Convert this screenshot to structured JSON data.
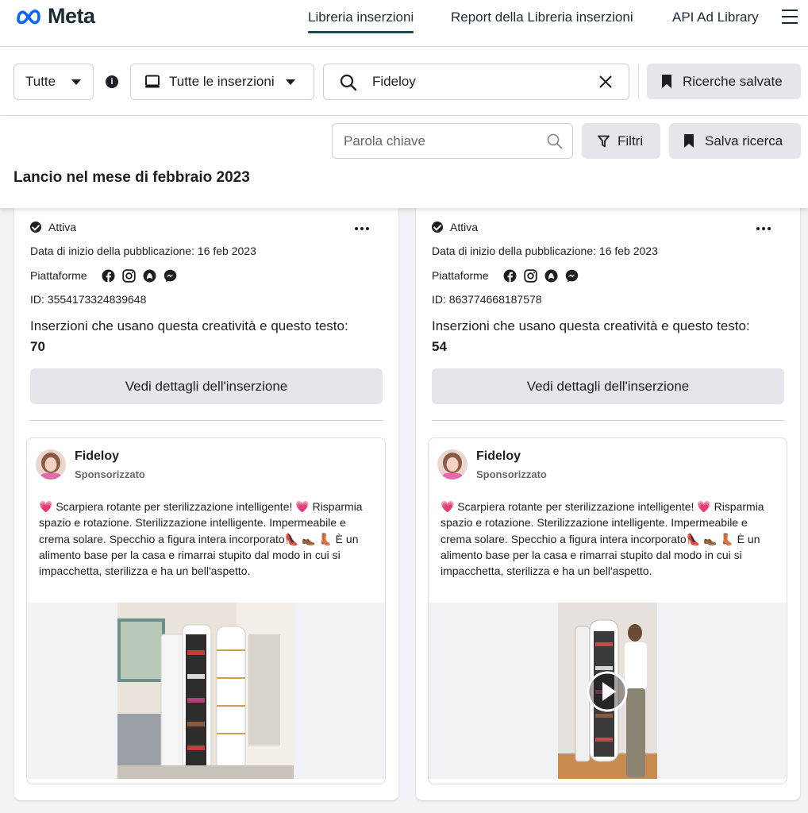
{
  "nav": {
    "brand": "Meta",
    "links": [
      "Libreria inserzioni",
      "Report della Libreria inserzioni",
      "API Ad Library"
    ]
  },
  "search": {
    "country": "Tutte",
    "ad_type": "Tutte le inserzioni",
    "query": "Fideloy",
    "saved_label": "Ricerche salvate"
  },
  "filters": {
    "keyword_placeholder": "Parola chiave",
    "filters_label": "Filtri",
    "save_label": "Salva ricerca"
  },
  "section_title": "Lancio nel mese di febbraio 2023",
  "cards": [
    {
      "status": "Attiva",
      "start_date": "Data di inizio della pubblicazione: 16 feb 2023",
      "platforms_label": "Piattaforme",
      "id": "ID: 3554173324839648",
      "usage_text": "Inserzioni che usano questa creatività e questo testo: ",
      "usage_count": "70",
      "details_button": "Vedi dettagli dell'inserzione",
      "advertiser": "Fideloy",
      "sponsored": "Sponsorizzato",
      "body": "💗 Scarpiera rotante per sterilizzazione intelligente! 💗 Risparmia spazio e rotazione. Sterilizzazione intelligente. Impermeabile e crema solare. Specchio a figura intera incorporato👠 👞 👢 È un alimento base per la casa e rimarrai stupito dal modo in cui si impacchetta, sterilizza e ha un bell'aspetto."
    },
    {
      "status": "Attiva",
      "start_date": "Data di inizio della pubblicazione: 16 feb 2023",
      "platforms_label": "Piattaforme",
      "id": "ID: 863774668187578",
      "usage_text": "Inserzioni che usano questa creatività e questo testo: ",
      "usage_count": "54",
      "details_button": "Vedi dettagli dell'inserzione",
      "advertiser": "Fideloy",
      "sponsored": "Sponsorizzato",
      "body": "💗 Scarpiera rotante per sterilizzazione intelligente! 💗 Risparmia spazio e rotazione. Sterilizzazione intelligente. Impermeabile e crema solare. Specchio a figura intera incorporato👠 👞 👢 È un alimento base per la casa e rimarrai stupito dal modo in cui si impacchetta, sterilizza e ha un bell'aspetto."
    }
  ],
  "icons": {
    "platforms": [
      "facebook-icon",
      "instagram-icon",
      "audience-network-icon",
      "messenger-icon"
    ]
  },
  "colors": {
    "meta_blue": "#0866ff",
    "nav_underline": "#1c4b53",
    "button_grey": "#e4e6eb"
  }
}
